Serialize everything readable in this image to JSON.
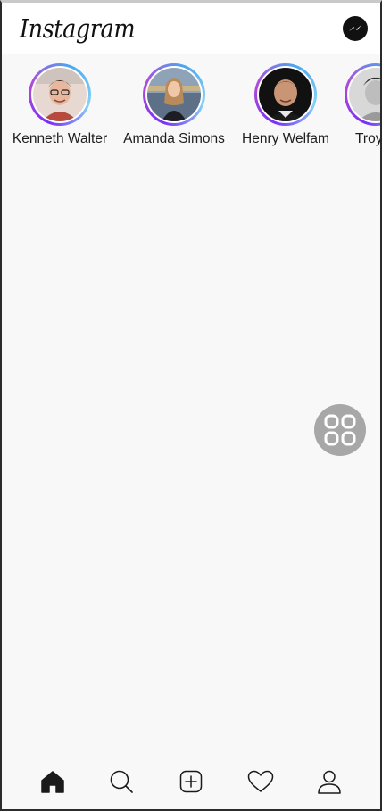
{
  "header": {
    "logo_text": "Instagram",
    "messenger_icon": "messenger-icon"
  },
  "stories": [
    {
      "name": "Kenneth Walter",
      "avatar_bg": "#c97f6c"
    },
    {
      "name": "Amanda Simons",
      "avatar_bg": "#5d6f86"
    },
    {
      "name": "Henry Welfam",
      "avatar_bg": "#2a2a2a"
    },
    {
      "name": "Troy C",
      "avatar_bg": "#cfcfcf"
    }
  ],
  "floating_button": {
    "icon": "grid-icon"
  },
  "bottom_nav": {
    "items": [
      {
        "icon": "home-icon",
        "active": true
      },
      {
        "icon": "search-icon",
        "active": false
      },
      {
        "icon": "add-post-icon",
        "active": false
      },
      {
        "icon": "heart-icon",
        "active": false
      },
      {
        "icon": "profile-icon",
        "active": false
      }
    ]
  },
  "colors": {
    "background": "#f8f8f8",
    "header_bg": "#ffffff",
    "ring_start": "#7b2ff7",
    "ring_end": "#86d3f5",
    "fab_bg": "#a7a7a7"
  }
}
